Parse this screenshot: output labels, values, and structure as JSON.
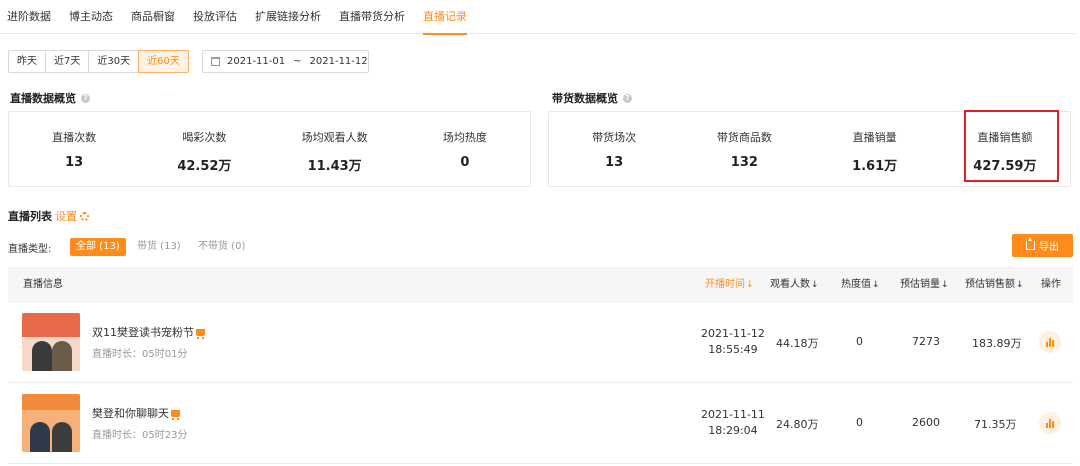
{
  "tabs": [
    "进阶数据",
    "博主动态",
    "商品橱窗",
    "投放评估",
    "扩展链接分析",
    "直播带货分析",
    "直播记录"
  ],
  "active_tab": 6,
  "date_filters": [
    "昨天",
    "近7天",
    "近30天",
    "近60天"
  ],
  "active_date_filter": 3,
  "date_range": {
    "start": "2021-11-01",
    "separator": "~",
    "end": "2021-11-12"
  },
  "live_overview": {
    "title": "直播数据概览",
    "stats": [
      {
        "label": "直播次数",
        "value": "13"
      },
      {
        "label": "喝彩次数",
        "value": "42.52万"
      },
      {
        "label": "场均观看人数",
        "value": "11.43万"
      },
      {
        "label": "场均热度",
        "value": "0"
      }
    ]
  },
  "sales_overview": {
    "title": "带货数据概览",
    "stats": [
      {
        "label": "带货场次",
        "value": "13"
      },
      {
        "label": "带货商品数",
        "value": "132"
      },
      {
        "label": "直播销量",
        "value": "1.61万"
      },
      {
        "label": "直播销售额",
        "value": "427.59万"
      }
    ]
  },
  "live_list": {
    "title": "直播列表",
    "settings_label": "设置",
    "type_label": "直播类型:",
    "types": [
      "全部 (13)",
      "带货 (13)",
      "不带货 (0)"
    ],
    "export_label": "导出"
  },
  "table": {
    "columns": [
      "直播信息",
      "开播时间",
      "观看人数",
      "热度值",
      "预估销量",
      "预估销售额",
      "操作"
    ],
    "sort_arrow": "↓",
    "rows": [
      {
        "title": "双11樊登读书宠粉节",
        "duration": "直播时长：05时01分",
        "date": "2021-11-12",
        "time": "18:55:49",
        "viewers": "44.18万",
        "heat": "0",
        "sales": "7273",
        "revenue": "183.89万"
      },
      {
        "title": "樊登和你聊聊天",
        "duration": "直播时长：05时23分",
        "date": "2021-11-11",
        "time": "18:29:04",
        "viewers": "24.80万",
        "heat": "0",
        "sales": "2600",
        "revenue": "71.35万"
      }
    ]
  },
  "colors": {
    "accent": "#ff8c1a",
    "highlight": "#e0202a"
  }
}
